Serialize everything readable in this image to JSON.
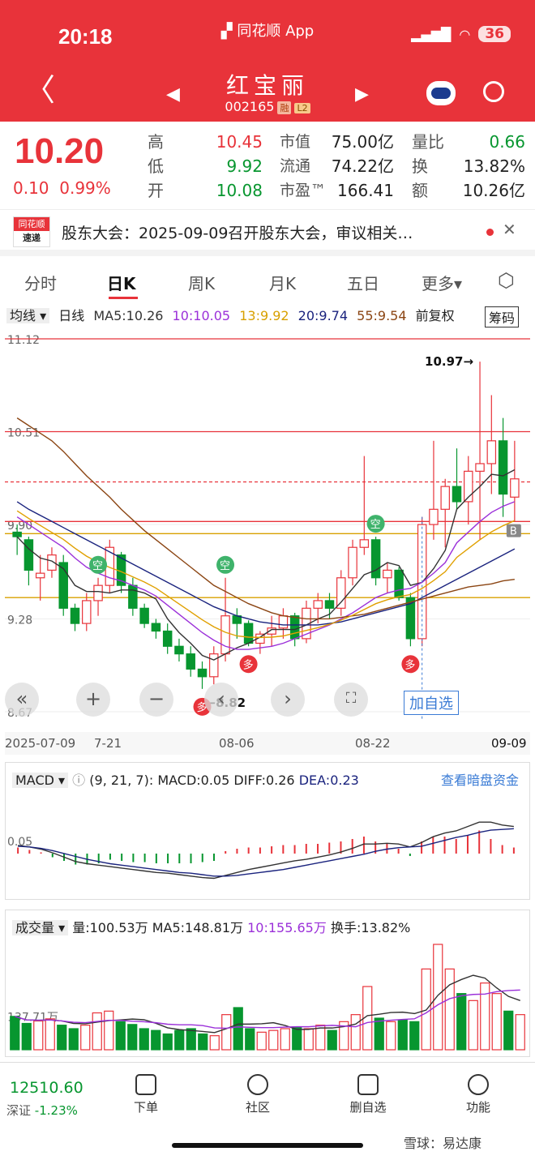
{
  "status_bar": {
    "time": "20:18",
    "app": "同花顺 App",
    "battery": "36"
  },
  "header": {
    "name": "红宝丽",
    "code": "002165",
    "tag_margin": "融",
    "tag_l2": "L2"
  },
  "quote": {
    "price": "10.20",
    "change": "0.10",
    "change_pct": "0.99%",
    "high_label": "高",
    "high": "10.45",
    "low_label": "低",
    "low": "9.92",
    "open_label": "开",
    "open": "10.08",
    "mcap_label": "市值",
    "mcap": "75.00亿",
    "float_label": "流通",
    "float": "74.22亿",
    "pe_label": "市盈™",
    "pe": "166.41",
    "vr_label": "量比",
    "vr": "0.66",
    "turn_label": "换",
    "turn": "13.82%",
    "amt_label": "额",
    "amt": "10.26亿"
  },
  "news": {
    "source1": "同花顺",
    "source2": "速递",
    "text": "股东大会：2025-09-09召开股东大会，审议相关…"
  },
  "tabs": [
    "分时",
    "日K",
    "周K",
    "月K",
    "五日",
    "更多▾"
  ],
  "active_tab": "日K",
  "kline_legend": {
    "type": "均线 ▾",
    "period": "日线",
    "ma5": "MA5:10.26",
    "ma10": "10:10.05",
    "ma13": "13:9.92",
    "ma20": "20:9.74",
    "ma55": "55:9.54",
    "adj": "前复权",
    "chip": "筹码"
  },
  "colors": {
    "up": "#e8333a",
    "down": "#07962f",
    "ma5": "#333333",
    "ma10": "#9b30d9",
    "ma13": "#e0a000",
    "ma20": "#1a237e",
    "ma55": "#8b4513"
  },
  "chart_data": [
    {
      "type": "candlestick",
      "title": "日K",
      "y_ticks": [
        "11.12",
        "10.51",
        "9.90",
        "9.28",
        "8.67"
      ],
      "x_labels": [
        "2025-07-09",
        "7-21",
        "08-06",
        "08-22",
        "09-09"
      ],
      "annotations": {
        "high_mark": "10.97→",
        "low_mark": "←8.82"
      },
      "candles": [
        [
          9.85,
          9.9,
          9.7,
          9.82
        ],
        [
          9.8,
          9.82,
          9.5,
          9.6
        ],
        [
          9.55,
          9.7,
          9.4,
          9.58
        ],
        [
          9.6,
          9.75,
          9.55,
          9.7
        ],
        [
          9.65,
          9.7,
          9.3,
          9.35
        ],
        [
          9.35,
          9.38,
          9.2,
          9.25
        ],
        [
          9.25,
          9.45,
          9.2,
          9.4
        ],
        [
          9.4,
          9.55,
          9.3,
          9.5
        ],
        [
          9.5,
          9.8,
          9.45,
          9.75
        ],
        [
          9.7,
          9.72,
          9.45,
          9.5
        ],
        [
          9.5,
          9.55,
          9.3,
          9.35
        ],
        [
          9.35,
          9.38,
          9.22,
          9.25
        ],
        [
          9.25,
          9.28,
          9.15,
          9.2
        ],
        [
          9.2,
          9.25,
          9.05,
          9.1
        ],
        [
          9.1,
          9.15,
          9.0,
          9.05
        ],
        [
          9.05,
          9.1,
          8.9,
          8.95
        ],
        [
          8.95,
          9.0,
          8.82,
          8.9
        ],
        [
          8.9,
          9.1,
          8.85,
          9.05
        ],
        [
          9.05,
          9.55,
          9.0,
          9.3
        ],
        [
          9.3,
          9.35,
          9.15,
          9.25
        ],
        [
          9.25,
          9.27,
          9.1,
          9.12
        ],
        [
          9.12,
          9.2,
          9.05,
          9.18
        ],
        [
          9.18,
          9.3,
          9.1,
          9.22
        ],
        [
          9.22,
          9.35,
          9.15,
          9.3
        ],
        [
          9.3,
          9.32,
          9.1,
          9.15
        ],
        [
          9.15,
          9.4,
          9.12,
          9.35
        ],
        [
          9.35,
          9.45,
          9.25,
          9.4
        ],
        [
          9.4,
          9.45,
          9.28,
          9.35
        ],
        [
          9.35,
          9.6,
          9.3,
          9.55
        ],
        [
          9.55,
          9.8,
          9.5,
          9.75
        ],
        [
          9.75,
          10.35,
          9.7,
          9.8
        ],
        [
          9.8,
          9.82,
          9.5,
          9.55
        ],
        [
          9.55,
          9.65,
          9.45,
          9.6
        ],
        [
          9.6,
          9.62,
          9.4,
          9.42
        ],
        [
          9.42,
          9.45,
          9.1,
          9.15
        ],
        [
          9.15,
          9.95,
          9.1,
          9.9
        ],
        [
          9.9,
          10.45,
          9.8,
          10.0
        ],
        [
          10.0,
          10.2,
          9.75,
          10.15
        ],
        [
          10.15,
          10.4,
          10.0,
          10.05
        ],
        [
          10.05,
          10.35,
          9.9,
          10.25
        ],
        [
          10.25,
          10.97,
          9.8,
          10.3
        ],
        [
          10.3,
          10.75,
          10.1,
          10.45
        ],
        [
          10.45,
          10.6,
          9.95,
          10.1
        ],
        [
          10.08,
          10.45,
          9.92,
          10.2
        ]
      ],
      "ma5": [
        9.82,
        9.74,
        9.68,
        9.66,
        9.61,
        9.5,
        9.46,
        9.46,
        9.45,
        9.47,
        9.47,
        9.45,
        9.41,
        9.28,
        9.19,
        9.12,
        9.04,
        9.01,
        9.05,
        9.09,
        9.12,
        9.16,
        9.21,
        9.21,
        9.21,
        9.24,
        9.28,
        9.31,
        9.39,
        9.48,
        9.57,
        9.6,
        9.65,
        9.63,
        9.5,
        9.52,
        9.61,
        9.73,
        10.0,
        10.08,
        10.15,
        10.23,
        10.22,
        10.26
      ],
      "ma10": [
        9.95,
        9.9,
        9.85,
        9.8,
        9.75,
        9.68,
        9.62,
        9.58,
        9.55,
        9.53,
        9.5,
        9.47,
        9.43,
        9.37,
        9.31,
        9.25,
        9.19,
        9.14,
        9.1,
        9.08,
        9.08,
        9.09,
        9.1,
        9.12,
        9.15,
        9.18,
        9.21,
        9.24,
        9.28,
        9.32,
        9.37,
        9.42,
        9.45,
        9.47,
        9.48,
        9.52,
        9.58,
        9.65,
        9.78,
        9.85,
        9.92,
        9.98,
        10.02,
        10.05
      ],
      "ma20": [
        10.05,
        10.0,
        9.96,
        9.92,
        9.88,
        9.84,
        9.8,
        9.76,
        9.72,
        9.68,
        9.64,
        9.6,
        9.56,
        9.52,
        9.48,
        9.44,
        9.4,
        9.36,
        9.33,
        9.3,
        9.28,
        9.26,
        9.25,
        9.24,
        9.24,
        9.24,
        9.24,
        9.25,
        9.26,
        9.28,
        9.3,
        9.32,
        9.34,
        9.36,
        9.38,
        9.42,
        9.46,
        9.5,
        9.54,
        9.58,
        9.62,
        9.66,
        9.7,
        9.74
      ],
      "ma55": [
        10.6,
        10.55,
        10.5,
        10.45,
        10.38,
        10.3,
        10.22,
        10.15,
        10.08,
        10.0,
        9.93,
        9.86,
        9.8,
        9.74,
        9.68,
        9.62,
        9.56,
        9.5,
        9.46,
        9.42,
        9.38,
        9.35,
        9.32,
        9.3,
        9.29,
        9.28,
        9.28,
        9.28,
        9.29,
        9.3,
        9.31,
        9.33,
        9.35,
        9.37,
        9.39,
        9.41,
        9.43,
        9.45,
        9.47,
        9.49,
        9.5,
        9.51,
        9.53,
        9.54
      ],
      "h_lines": [
        {
          "value": 11.12,
          "color": "#e8333a"
        },
        {
          "value": 10.51,
          "color": "#e8333a"
        },
        {
          "value": 10.18,
          "color": "#e8333a",
          "dashed": true
        },
        {
          "value": 9.92,
          "color": "#e8333a"
        },
        {
          "value": 9.84,
          "color": "#d8a000"
        },
        {
          "value": 9.42,
          "color": "#d8a000"
        }
      ]
    },
    {
      "type": "bar",
      "title": "MACD",
      "legend": {
        "name": "MACD ▾",
        "params": "(9, 21, 7):",
        "macd": "MACD:0.05",
        "diff": "DIFF:0.26",
        "dea": "DEA:0.23",
        "link": "查看暗盘资金"
      },
      "y_tick": "0.05",
      "hist": [
        0.05,
        0.03,
        0.01,
        -0.03,
        -0.06,
        -0.09,
        -0.09,
        -0.08,
        -0.05,
        -0.06,
        -0.07,
        -0.07,
        -0.08,
        -0.08,
        -0.08,
        -0.08,
        -0.07,
        -0.06,
        0.02,
        0.04,
        0.05,
        0.05,
        0.06,
        0.07,
        0.07,
        0.08,
        0.08,
        0.09,
        0.1,
        0.12,
        0.14,
        0.1,
        0.08,
        0.04,
        -0.02,
        0.1,
        0.14,
        0.14,
        0.12,
        0.15,
        0.19,
        0.12,
        0.07,
        0.05
      ],
      "diff": [
        0.0,
        -0.02,
        -0.05,
        -0.1,
        -0.16,
        -0.22,
        -0.25,
        -0.27,
        -0.29,
        -0.31,
        -0.33,
        -0.35,
        -0.37,
        -0.38,
        -0.4,
        -0.42,
        -0.44,
        -0.45,
        -0.41,
        -0.37,
        -0.33,
        -0.3,
        -0.27,
        -0.24,
        -0.21,
        -0.19,
        -0.16,
        -0.13,
        -0.09,
        -0.04,
        0.02,
        0.02,
        0.03,
        0.02,
        -0.02,
        0.04,
        0.12,
        0.17,
        0.2,
        0.26,
        0.32,
        0.32,
        0.28,
        0.26
      ],
      "dea": [
        -0.01,
        -0.02,
        -0.04,
        -0.07,
        -0.11,
        -0.15,
        -0.19,
        -0.22,
        -0.25,
        -0.27,
        -0.29,
        -0.31,
        -0.33,
        -0.35,
        -0.37,
        -0.38,
        -0.4,
        -0.42,
        -0.42,
        -0.41,
        -0.39,
        -0.37,
        -0.35,
        -0.33,
        -0.3,
        -0.27,
        -0.24,
        -0.21,
        -0.18,
        -0.15,
        -0.12,
        -0.08,
        -0.05,
        -0.03,
        -0.02,
        -0.01,
        0.03,
        0.07,
        0.11,
        0.14,
        0.18,
        0.21,
        0.22,
        0.23
      ]
    },
    {
      "type": "bar",
      "title": "成交量",
      "legend": {
        "name": "成交量 ▾",
        "vol": "量:100.53万",
        "ma5": "MA5:148.81万",
        "ma10": "10:155.65万",
        "turn": "换手:13.82%"
      },
      "y_tick": "137.71万",
      "volumes": [
        95,
        75,
        82,
        88,
        70,
        60,
        70,
        105,
        110,
        80,
        72,
        60,
        55,
        45,
        55,
        60,
        45,
        40,
        100,
        120,
        60,
        50,
        55,
        60,
        65,
        60,
        70,
        55,
        80,
        100,
        180,
        90,
        80,
        85,
        80,
        230,
        300,
        230,
        160,
        140,
        190,
        160,
        110,
        100
      ]
    }
  ],
  "overlay": {
    "add_watch": "加自选",
    "tag_kong": "空",
    "tag_duo": "多",
    "tag_b": "B"
  },
  "bottom": {
    "index": "12510.60",
    "market": "深证",
    "pct": "-1.23%",
    "items": [
      "下单",
      "社区",
      "删自选",
      "功能"
    ],
    "watermark": "雪球：易达康"
  }
}
